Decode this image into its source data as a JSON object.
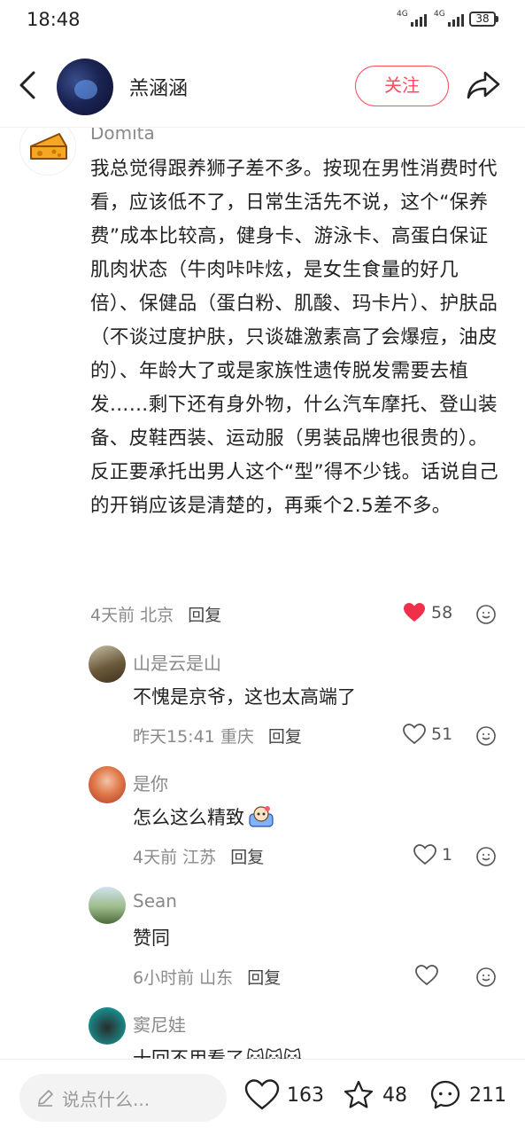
{
  "status_bar": {
    "time": "18:48",
    "network1": "4G",
    "network2": "4G",
    "battery": "38"
  },
  "header": {
    "name": "羔涵涵",
    "follow_label": "关注"
  },
  "main_comment": {
    "username": "Domita",
    "text": "我总觉得跟养狮子差不多。按现在男性消费时代看，应该低不了，日常生活先不说，这个“保养费”成本比较高，健身卡、游泳卡、高蛋白保证肌肉状态（牛肉咔咔炫，是女生食量的好几倍）、保健品（蛋白粉、肌酸、玛卡片）、护肤品（不谈过度护肤，只谈雄激素高了会爆痘，油皮的）、年龄大了或是家族性遗传脱发需要去植发……剩下还有身外物，什么汽车摩托、登山装备、皮鞋西装、运动服（男装品牌也很贵的）。反正要承托出男人这个“型”得不少钱。话说自己的开销应该是清楚的，再乘个2.5差不多。",
    "time": "4天前",
    "location": "北京",
    "reply_label": "回复",
    "likes": "58"
  },
  "replies": [
    {
      "username": "山是云是山",
      "text": "不愧是京爷，这也太高端了",
      "time": "昨天15:41",
      "location": "重庆",
      "reply_label": "回复",
      "likes": "51"
    },
    {
      "username": "是你",
      "text": "怎么这么精致",
      "time": "4天前",
      "location": "江苏",
      "reply_label": "回复",
      "likes": "1"
    },
    {
      "username": "Sean",
      "text": "赞同",
      "time": "6小时前",
      "location": "山东",
      "reply_label": "回复",
      "likes": ""
    },
    {
      "username": "窦尼娃",
      "text": "十回不用看了"
    }
  ],
  "bottom_bar": {
    "input_placeholder": "说点什么...",
    "likes": "163",
    "favorites": "48",
    "comments": "211"
  },
  "colors": {
    "accent": "#ff4d5e",
    "liked_heart": "#f0304a",
    "meta_gray": "#8a8a8a"
  }
}
